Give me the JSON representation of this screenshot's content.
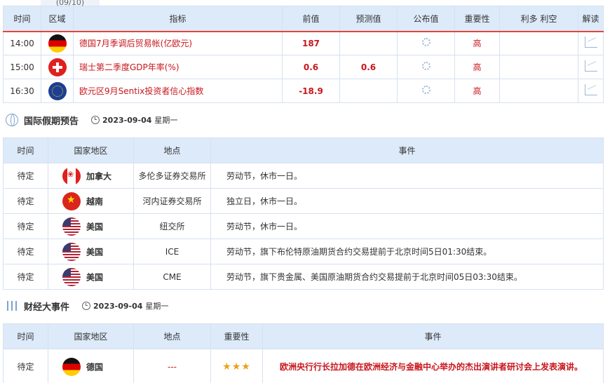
{
  "tooltip": "(09/10)",
  "calendar": {
    "headers": [
      "时间",
      "区域",
      "指标",
      "前值",
      "预测值",
      "公布值",
      "重要性",
      "利多 利空",
      "解读"
    ],
    "rows": [
      {
        "time": "14:00",
        "flag": "flag-de",
        "indicator": "德国7月季调后贸易帐(亿欧元)",
        "prev": "187",
        "forecast": "",
        "actual": "",
        "importance": "高"
      },
      {
        "time": "15:00",
        "flag": "flag-ch",
        "indicator": "瑞士第二季度GDP年率(%)",
        "prev": "0.6",
        "forecast": "0.6",
        "actual": "",
        "importance": "高"
      },
      {
        "time": "16:30",
        "flag": "flag-eu",
        "indicator": "欧元区9月Sentix投资者信心指数",
        "prev": "-18.9",
        "forecast": "",
        "actual": "",
        "importance": "高"
      }
    ]
  },
  "holiday": {
    "title": "国际假期预告",
    "date": "2023-09-04",
    "weekday": "星期一",
    "headers": [
      "时间",
      "国家地区",
      "地点",
      "事件"
    ],
    "rows": [
      {
        "time": "待定",
        "flag": "flag-ca",
        "country": "加拿大",
        "place": "多伦多证券交易所",
        "event": "劳动节，休市一日。"
      },
      {
        "time": "待定",
        "flag": "flag-vn",
        "country": "越南",
        "place": "河内证券交易所",
        "event": "独立日，休市一日。"
      },
      {
        "time": "待定",
        "flag": "flag-us",
        "country": "美国",
        "place": "纽交所",
        "event": "劳动节，休市一日。"
      },
      {
        "time": "待定",
        "flag": "flag-us",
        "country": "美国",
        "place": "ICE",
        "event": "劳动节，旗下布伦特原油期货合约交易提前于北京时间5日01:30结束。"
      },
      {
        "time": "待定",
        "flag": "flag-us",
        "country": "美国",
        "place": "CME",
        "event": "劳动节，旗下贵金属、美国原油期货合约交易提前于北京时间05日03:30结束。"
      }
    ]
  },
  "events": {
    "title": "财经大事件",
    "date": "2023-09-04",
    "weekday": "星期一",
    "headers": [
      "时间",
      "国家地区",
      "地点",
      "重要性",
      "事件"
    ],
    "rows": [
      {
        "time": "待定",
        "flag": "flag-de",
        "country": "德国",
        "place": "---",
        "stars": "★★★",
        "event": "欧洲央行行长拉加德在欧洲经济与金融中心举办的杰出演讲者研讨会上发表演讲。"
      }
    ]
  },
  "icons": {
    "section1": "globe-icon",
    "section2": "sliders-icon",
    "clock": "clock-icon",
    "pending": "loading-icon",
    "analysis": "chart-icon"
  },
  "colors": {
    "header_bg": "#ddeaf9",
    "accent_red": "#c8161d",
    "star": "#e8a317"
  }
}
